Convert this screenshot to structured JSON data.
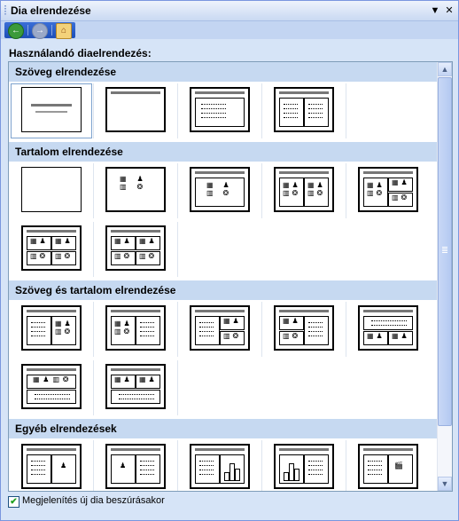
{
  "window": {
    "title": "Dia elrendezése"
  },
  "toolbar": {
    "back": "back-icon",
    "forward": "forward-icon",
    "home": "home-icon"
  },
  "label": "Használandó diaelrendezés:",
  "categories": [
    {
      "title": "Szöveg elrendezése"
    },
    {
      "title": "Tartalom elrendezése"
    },
    {
      "title": "Szöveg és tartalom elrendezése"
    },
    {
      "title": "Egyéb elrendezések"
    }
  ],
  "footer": {
    "checkbox_label": "Megjelenítés új dia beszúrásakor",
    "checked": true
  },
  "colors": {
    "header": "#c6d9f1",
    "pane": "#d6e4f7",
    "accent": "#3a6ed7"
  }
}
